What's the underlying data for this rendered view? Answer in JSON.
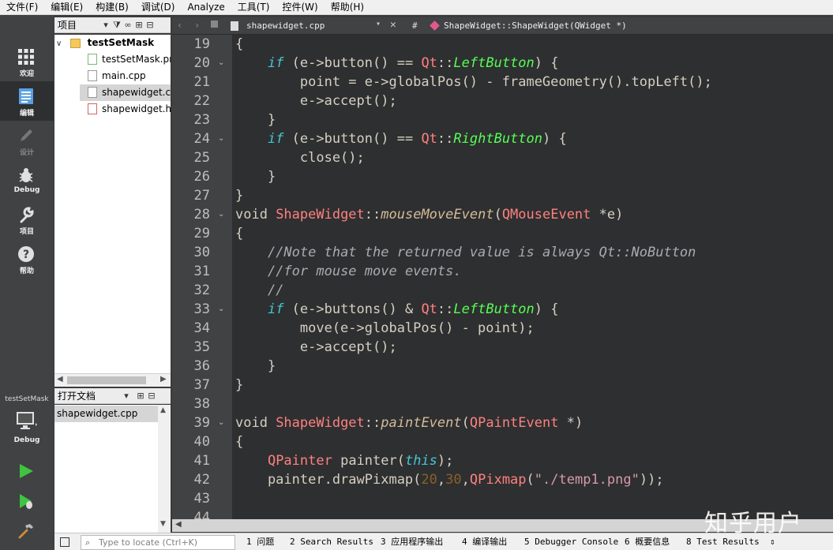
{
  "menu": [
    "文件(F)",
    "编辑(E)",
    "构建(B)",
    "调试(D)",
    "Analyze",
    "工具(T)",
    "控件(W)",
    "帮助(H)"
  ],
  "modes": [
    {
      "label": "欢迎",
      "icon": "grid-icon"
    },
    {
      "label": "编辑",
      "icon": "edit-document-icon"
    },
    {
      "label": "设计",
      "icon": "pencil-icon"
    },
    {
      "label": "Debug",
      "icon": "bug-icon"
    },
    {
      "label": "项目",
      "icon": "wrench-icon"
    },
    {
      "label": "帮助",
      "icon": "help-icon"
    }
  ],
  "kit": {
    "project": "testSetMask",
    "mode": "Debug"
  },
  "projects_panel": {
    "title": "项目",
    "root": "testSetMask",
    "files": [
      {
        "name": "testSetMask.pr",
        "icon": "qt-project-file-icon"
      },
      {
        "name": "main.cpp",
        "icon": "cpp-file-icon"
      },
      {
        "name": "shapewidget.cp",
        "icon": "cpp-file-icon"
      },
      {
        "name": "shapewidget.h",
        "icon": "header-file-icon"
      }
    ]
  },
  "open_documents": {
    "title": "打开文档",
    "files": [
      "shapewidget.cpp"
    ]
  },
  "editor": {
    "file": "shapewidget.cpp",
    "hash": "#",
    "symbol": "ShapeWidget::ShapeWidget(QWidget *)",
    "lines": [
      {
        "n": "19",
        "fold": "",
        "tokens": [
          [
            "plain",
            "{"
          ]
        ]
      },
      {
        "n": "20",
        "fold": "v",
        "tokens": [
          [
            "plain",
            "    "
          ],
          [
            "kw",
            "if"
          ],
          [
            "plain",
            " (e->button() == "
          ],
          [
            "type",
            "Qt"
          ],
          [
            "plain",
            "::"
          ],
          [
            "enum",
            "LeftButton"
          ],
          [
            "plain",
            ") {"
          ]
        ]
      },
      {
        "n": "21",
        "fold": "",
        "tokens": [
          [
            "plain",
            "        point = e->globalPos() - frameGeometry().topLeft();"
          ]
        ]
      },
      {
        "n": "22",
        "fold": "",
        "tokens": [
          [
            "plain",
            "        e->accept();"
          ]
        ]
      },
      {
        "n": "23",
        "fold": "",
        "tokens": [
          [
            "plain",
            "    }"
          ]
        ]
      },
      {
        "n": "24",
        "fold": "v",
        "tokens": [
          [
            "plain",
            "    "
          ],
          [
            "kw",
            "if"
          ],
          [
            "plain",
            " (e->button() == "
          ],
          [
            "type",
            "Qt"
          ],
          [
            "plain",
            "::"
          ],
          [
            "enum",
            "RightButton"
          ],
          [
            "plain",
            ") {"
          ]
        ]
      },
      {
        "n": "25",
        "fold": "",
        "tokens": [
          [
            "plain",
            "        close();"
          ]
        ]
      },
      {
        "n": "26",
        "fold": "",
        "tokens": [
          [
            "plain",
            "    }"
          ]
        ]
      },
      {
        "n": "27",
        "fold": "",
        "tokens": [
          [
            "plain",
            "}"
          ]
        ]
      },
      {
        "n": "28",
        "fold": "v",
        "tokens": [
          [
            "plain",
            "void "
          ],
          [
            "type",
            "ShapeWidget"
          ],
          [
            "plain",
            "::"
          ],
          [
            "func",
            "mouseMoveEvent"
          ],
          [
            "plain",
            "("
          ],
          [
            "type",
            "QMouseEvent"
          ],
          [
            "plain",
            " *e)"
          ]
        ]
      },
      {
        "n": "29",
        "fold": "",
        "tokens": [
          [
            "plain",
            "{"
          ]
        ]
      },
      {
        "n": "30",
        "fold": "",
        "tokens": [
          [
            "plain",
            "    "
          ],
          [
            "comment",
            "//Note that the returned value is always Qt::NoButton"
          ]
        ]
      },
      {
        "n": "31",
        "fold": "",
        "tokens": [
          [
            "plain",
            "    "
          ],
          [
            "comment",
            "//for mouse move events."
          ]
        ]
      },
      {
        "n": "32",
        "fold": "",
        "tokens": [
          [
            "plain",
            "    "
          ],
          [
            "comment",
            "//"
          ]
        ]
      },
      {
        "n": "33",
        "fold": "v",
        "tokens": [
          [
            "plain",
            "    "
          ],
          [
            "kw",
            "if"
          ],
          [
            "plain",
            " (e->buttons() & "
          ],
          [
            "type",
            "Qt"
          ],
          [
            "plain",
            "::"
          ],
          [
            "enum",
            "LeftButton"
          ],
          [
            "plain",
            ") {"
          ]
        ]
      },
      {
        "n": "34",
        "fold": "",
        "tokens": [
          [
            "plain",
            "        move(e->globalPos() - point);"
          ]
        ]
      },
      {
        "n": "35",
        "fold": "",
        "tokens": [
          [
            "plain",
            "        e->accept();"
          ]
        ]
      },
      {
        "n": "36",
        "fold": "",
        "tokens": [
          [
            "plain",
            "    }"
          ]
        ]
      },
      {
        "n": "37",
        "fold": "",
        "tokens": [
          [
            "plain",
            "}"
          ]
        ]
      },
      {
        "n": "38",
        "fold": "",
        "tokens": [
          [
            "plain",
            ""
          ]
        ]
      },
      {
        "n": "39",
        "fold": "v",
        "tokens": [
          [
            "plain",
            "void "
          ],
          [
            "type",
            "ShapeWidget"
          ],
          [
            "plain",
            "::"
          ],
          [
            "func",
            "paintEvent"
          ],
          [
            "plain",
            "("
          ],
          [
            "type",
            "QPaintEvent"
          ],
          [
            "plain",
            " *)"
          ]
        ]
      },
      {
        "n": "40",
        "fold": "",
        "tokens": [
          [
            "plain",
            "{"
          ]
        ]
      },
      {
        "n": "41",
        "fold": "",
        "tokens": [
          [
            "plain",
            "    "
          ],
          [
            "type",
            "QPainter"
          ],
          [
            "plain",
            " painter("
          ],
          [
            "kw",
            "this"
          ],
          [
            "plain",
            ");"
          ]
        ]
      },
      {
        "n": "42",
        "fold": "",
        "tokens": [
          [
            "plain",
            "    painter.drawPixmap("
          ],
          [
            "num",
            "20"
          ],
          [
            "plain",
            ","
          ],
          [
            "num",
            "30"
          ],
          [
            "plain",
            ","
          ],
          [
            "type",
            "QPixmap"
          ],
          [
            "plain",
            "("
          ],
          [
            "str",
            "\"./temp1.png\""
          ],
          [
            "plain",
            "));"
          ]
        ]
      },
      {
        "n": "43",
        "fold": "",
        "tokens": [
          [
            "plain",
            ""
          ]
        ]
      },
      {
        "n": "44",
        "fold": "",
        "tokens": [
          [
            "plain",
            ""
          ]
        ]
      }
    ]
  },
  "status": {
    "locate_placeholder": "Type to locate (Ctrl+K)",
    "tabs": [
      "1 问题",
      "2 Search Results",
      "3 应用程序输出",
      "4 编译输出",
      "5 Debugger Console",
      "6 概要信息",
      "8 Test Results"
    ]
  },
  "watermark": "知乎用户"
}
